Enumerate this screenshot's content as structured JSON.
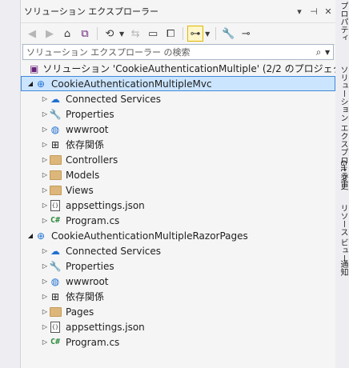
{
  "panel": {
    "title": "ソリューション エクスプローラー",
    "title_buttons": [
      "▾",
      "⊣",
      "✕"
    ]
  },
  "toolbar": {
    "back_icon": "back-arrow-icon",
    "forward_icon": "forward-arrow-icon",
    "home_icon": "home-icon",
    "switch_views_icon": "switch-views-icon",
    "history_icon": "history-icon",
    "sync_icon": "sync-icon",
    "collapse_icon": "collapse-all-icon",
    "show_all_icon": "show-all-files-icon",
    "preview_icon": "preview-icon",
    "properties_icon": "wrench-icon",
    "settings_icon": "pin-icon"
  },
  "search": {
    "placeholder": "ソリューション エクスプローラー の検索"
  },
  "tree": {
    "solution": "ソリューション 'CookieAuthenticationMultiple' (2/2 のプロジェクト)",
    "project1": {
      "name": "CookieAuthenticationMultipleMvc",
      "items": {
        "connected": "Connected Services",
        "properties": "Properties",
        "wwwroot": "wwwroot",
        "deps": "依存関係",
        "controllers": "Controllers",
        "models": "Models",
        "views": "Views",
        "appsettings": "appsettings.json",
        "program": "Program.cs"
      }
    },
    "project2": {
      "name": "CookieAuthenticationMultipleRazorPages",
      "items": {
        "connected": "Connected Services",
        "properties": "Properties",
        "wwwroot": "wwwroot",
        "deps": "依存関係",
        "pages": "Pages",
        "appsettings": "appsettings.json",
        "program": "Program.cs"
      }
    }
  },
  "side_tabs": {
    "properties": "プロパティ",
    "solution_explorer": "ソリューション エクスプローラー",
    "git_changes": "Git 変更",
    "resource_view": "リソース ビュー",
    "notifications": "通知"
  },
  "colors": {
    "selected_bg": "#cce5ff",
    "selected_border": "#3f89d9",
    "folder": "#dcb67a",
    "csharp": "#2c8a3a",
    "globe": "#1f6fd1"
  }
}
